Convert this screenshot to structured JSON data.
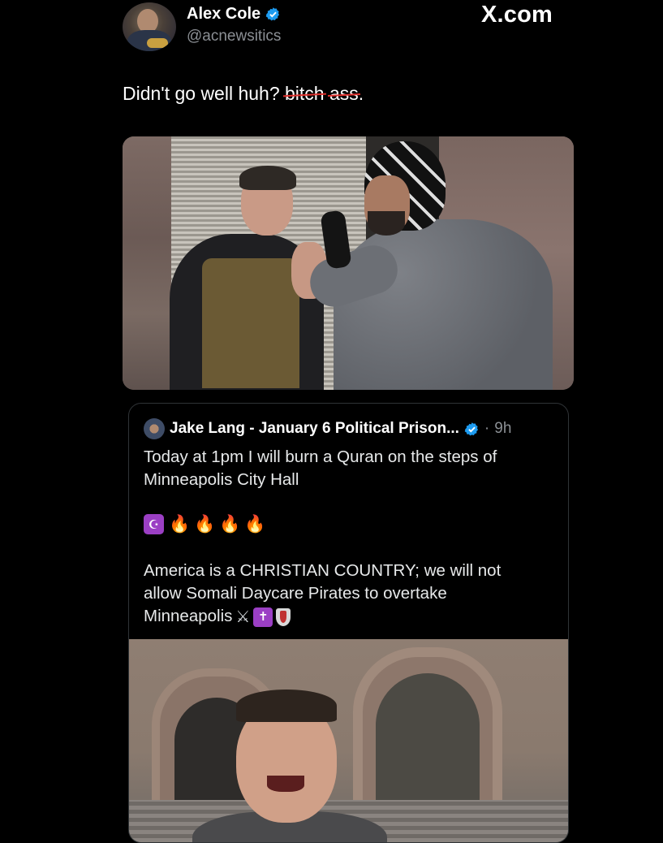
{
  "author": {
    "name": "Alex Cole",
    "handle": "@acnewsitics",
    "verified": true
  },
  "site_brand": "X.com",
  "tweet": {
    "text_prefix": "Didn't go well huh? ",
    "strike_word_1": "bitch",
    "text_middle": " ",
    "strike_word_2": "ass",
    "text_suffix": "."
  },
  "quoted_tweet": {
    "author_name": "Jake Lang - January 6 Political Prison...",
    "separator": "·",
    "time": "9h",
    "verified": true,
    "paragraph_1_line_1": "Today at 1pm I will burn a Quran on the steps of",
    "paragraph_1_line_2": "Minneapolis City Hall",
    "emoji_moon": "☪",
    "emoji_fire": "🔥",
    "paragraph_2_line_1": "America is a CHRISTIAN COUNTRY; we will not",
    "paragraph_2_line_2": "allow Somali Daycare Pirates to overtake",
    "paragraph_2_line_3": "Minneapolis",
    "emoji_swords": "⚔",
    "emoji_cross": "✝"
  },
  "colors": {
    "background": "#000000",
    "verified_blue": "#1d9bf0",
    "secondary_text": "#8b8f94",
    "strike_red": "#e0322e"
  },
  "icons": [
    "verified-badge-icon",
    "crescent-star-icon",
    "fire-icon",
    "crossed-swords-icon",
    "cross-icon",
    "shield-icon"
  ]
}
